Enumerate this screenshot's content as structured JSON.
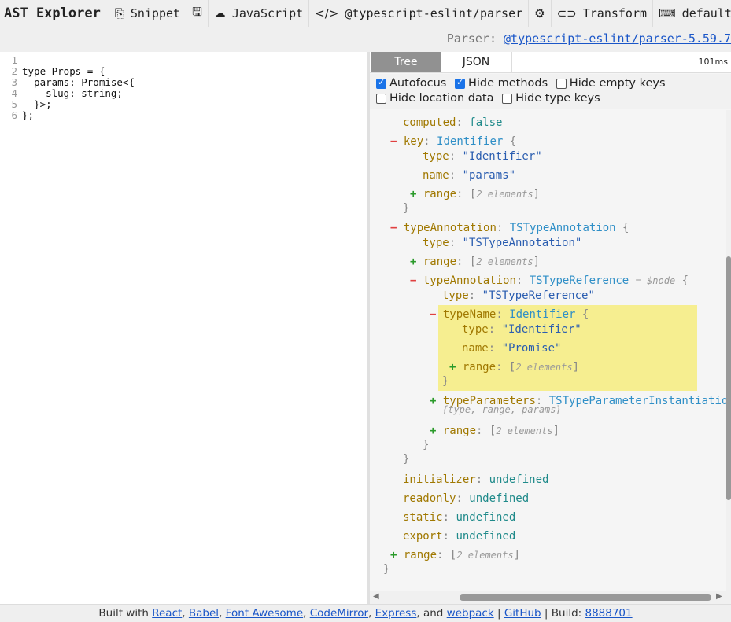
{
  "toolbar": {
    "title": "AST Explorer",
    "snippet_label": "Snippet",
    "language_label": "JavaScript",
    "parser_label": "@typescript-eslint/parser",
    "transform_label": "Transform",
    "keymap_label": "default",
    "help_label": "?"
  },
  "parser_info": {
    "prefix": "Parser:",
    "name": "@typescript-eslint/parser-5.59.7"
  },
  "editor": {
    "lines": [
      {
        "num": "1",
        "text": ""
      },
      {
        "num": "2",
        "text": "type Props = {"
      },
      {
        "num": "3",
        "text": "  params: Promise<{"
      },
      {
        "num": "4",
        "text": "    slug: string;"
      },
      {
        "num": "5",
        "text": "  }>;"
      },
      {
        "num": "6",
        "text": "};"
      }
    ]
  },
  "output": {
    "tabs": [
      {
        "label": "Tree"
      },
      {
        "label": "JSON"
      }
    ],
    "timing": "101ms",
    "options": [
      {
        "label": "Autofocus",
        "checked": true
      },
      {
        "label": "Hide methods",
        "checked": true
      },
      {
        "label": "Hide empty keys",
        "checked": false
      },
      {
        "label": "Hide location data",
        "checked": false
      },
      {
        "label": "Hide type keys",
        "checked": false
      }
    ]
  },
  "tree": {
    "computed_key": "computed",
    "computed_val": "false",
    "key_key": "key",
    "key_type": "Identifier",
    "key_type_str": "\"Identifier\"",
    "key_name_str": "\"params\"",
    "typeAnnotation_key": "typeAnnotation",
    "typeAnnotation_type": "TSTypeAnnotation",
    "typeAnnotation_type_str": "\"TSTypeAnnotation\"",
    "inner_typeAnnotation_type": "TSTypeReference",
    "node_marker": "= $node",
    "inner_type_str": "\"TSTypeReference\"",
    "typeName_key": "typeName",
    "typeName_type": "Identifier",
    "typeName_type_str": "\"Identifier\"",
    "typeName_name_str": "\"Promise\"",
    "typeParameters_key": "typeParameters",
    "typeParameters_type": "TSTypeParameterInstantiation",
    "typeParameters_summary": "{type, range, params}",
    "range_key": "range",
    "range_val": "2 elements",
    "type_key": "type",
    "name_key": "name",
    "initializer_key": "initializer",
    "readonly_key": "readonly",
    "static_key": "static",
    "export_key": "export",
    "undefined_val": "undefined"
  },
  "footer": {
    "built_with": "Built with",
    "links": [
      "React",
      "Babel",
      "Font Awesome",
      "CodeMirror",
      "Express",
      "webpack",
      "GitHub"
    ],
    "and": "and",
    "build_label": "Build:",
    "build_id": "8888701"
  }
}
